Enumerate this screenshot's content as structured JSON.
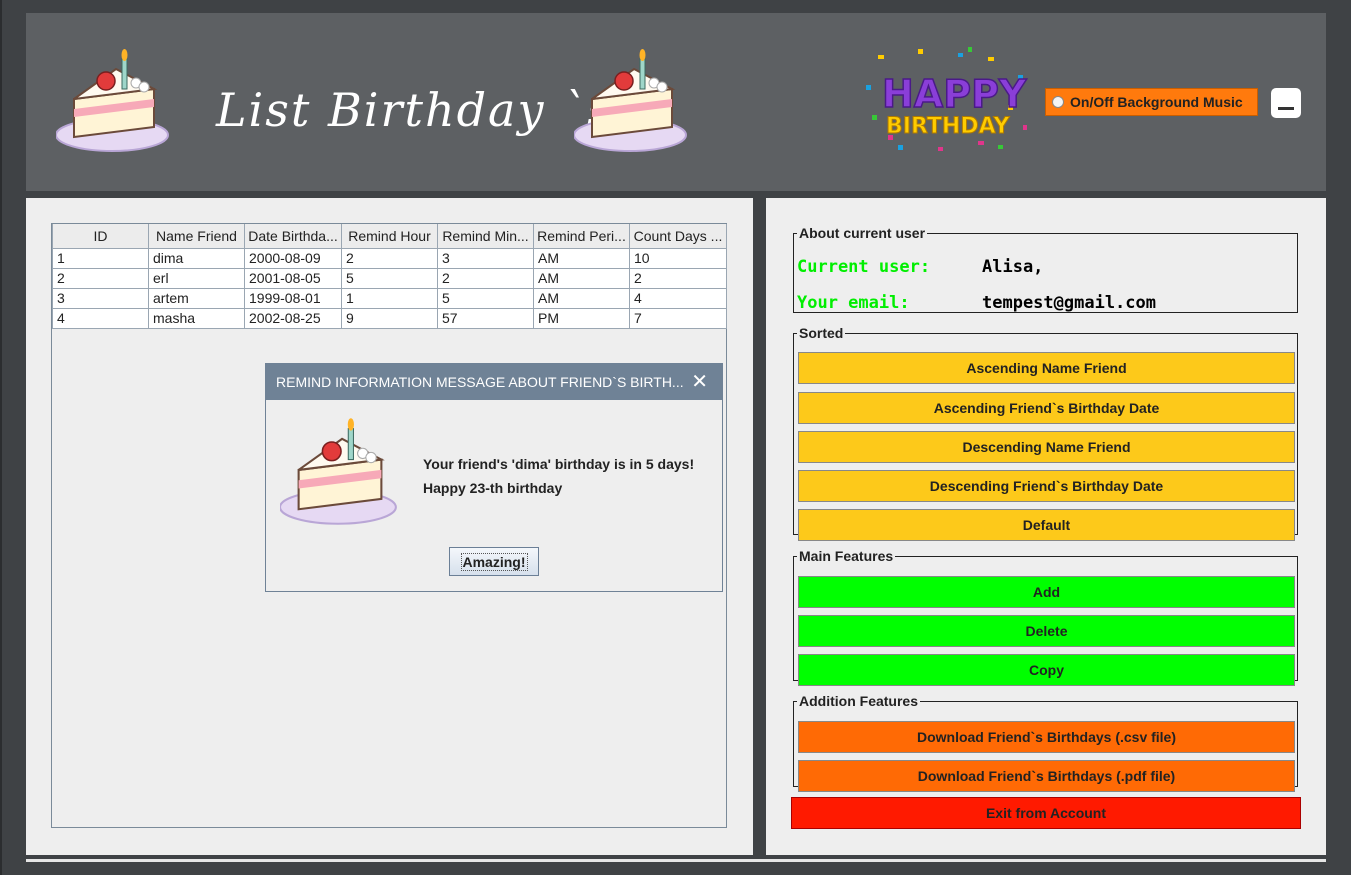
{
  "header": {
    "title": "List Birthday `s",
    "logo_icon": "happy-birthday-logo",
    "music_toggle_label": "On/Off Background Music",
    "minimize_icon": "minimize-icon"
  },
  "table": {
    "columns": [
      "ID",
      "Name Friend",
      "Date Birthda...",
      "Remind Hour",
      "Remind Min...",
      "Remind Peri...",
      "Count Days ..."
    ],
    "rows": [
      [
        "1",
        "dima",
        "2000-08-09",
        "2",
        "3",
        "AM",
        "10"
      ],
      [
        "2",
        "erl",
        "2001-08-05",
        "5",
        "2",
        "AM",
        "2"
      ],
      [
        "3",
        "artem",
        "1999-08-01",
        "1",
        "5",
        "AM",
        "4"
      ],
      [
        "4",
        "masha",
        "2002-08-25",
        "9",
        "57",
        "PM",
        "7"
      ]
    ]
  },
  "dialog": {
    "title": "REMIND INFORMATION MESSAGE ABOUT FRIEND`S BIRTH...",
    "close_label": "✕",
    "line1": "Your friend's 'dima' birthday is in 5 days!",
    "line2": "Happy 23-th birthday",
    "ok_label": "Amazing!"
  },
  "user": {
    "legend": "About current user",
    "user_label": "Current user:",
    "user_value": "Alisa,",
    "email_label": "Your email:",
    "email_value": "tempest@gmail.com"
  },
  "sorted": {
    "legend": "Sorted",
    "buttons": [
      "Ascending Name Friend",
      "Ascending Friend`s Birthday Date",
      "Descending Name Friend",
      "Descending Friend`s Birthday Date",
      "Default"
    ]
  },
  "main_features": {
    "legend": "Main Features",
    "buttons": [
      "Add",
      "Delete",
      "Copy"
    ]
  },
  "addition_features": {
    "legend": "Addition Features",
    "buttons": [
      "Download Friend`s Birthdays (.csv file)",
      "Download Friend`s Birthdays (.pdf file)"
    ]
  },
  "exit_label": "Exit from Account",
  "colors": {
    "sorted": "#fdc91a",
    "main": "#00ff00",
    "addition": "#ff6a05",
    "exit": "#ff1a00",
    "accent_text": "#00ee00"
  }
}
